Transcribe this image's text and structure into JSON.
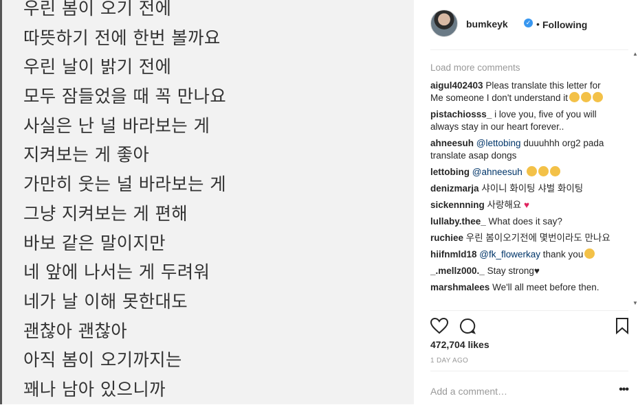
{
  "photo": {
    "lines": [
      "우린 봄이 오기 전에",
      "따뜻하기 전에 한번 볼까요",
      "우린 날이 밝기 전에",
      "모두 잠들었을 때 꼭 만나요",
      "사실은 난 널 바라보는 게",
      "지켜보는 게 좋아",
      "가만히 웃는 널 바라보는 게",
      "그냥 지켜보는 게 편해",
      "바보 같은 말이지만",
      "네 앞에 나서는 게 두려워",
      "네가 날 이해 못한대도",
      "괜찮아 괜찮아",
      "아직 봄이 오기까지는",
      "꽤나 남아 있으니까"
    ]
  },
  "header": {
    "username": "bumkeyk",
    "separator": "•",
    "follow_status": "Following"
  },
  "comments": {
    "load_more": "Load more comments",
    "items": [
      {
        "user": "aigul402403",
        "mention": "",
        "text": "Pleas translate this letter for Me someone I don't understand it",
        "emoji": 3
      },
      {
        "user": "pistachiosss_",
        "mention": "",
        "text": "i love you, five of you will always stay in our heart forever..",
        "emoji": 0
      },
      {
        "user": "ahneesuh",
        "mention": "@lettobing",
        "text": "duuuhhh org2 pada translate asap dongs",
        "emoji": 0
      },
      {
        "user": "lettobing",
        "mention": "@ahneesuh",
        "text": "",
        "emoji": 3
      },
      {
        "user": "denizmarja",
        "mention": "",
        "text": "샤이니 화이팅 샤벌 화이팅",
        "emoji": 0
      },
      {
        "user": "sickennning",
        "mention": "",
        "text": "사랑해요",
        "emoji": 0,
        "heart": "♥"
      },
      {
        "user": "lullaby.thee_",
        "mention": "",
        "text": "What does it say?",
        "emoji": 0
      },
      {
        "user": "ruchiee",
        "mention": "",
        "text": "우린 봄이오기전에 몇번이라도 만나요",
        "emoji": 0
      },
      {
        "user": "hiifnmld18",
        "mention": "@fk_flowerkay",
        "text": "thank you",
        "emoji": 1
      },
      {
        "user": "_.mellz000._",
        "mention": "",
        "text": "Stay strong♥",
        "emoji": 0
      },
      {
        "user": "marshmalees",
        "mention": "",
        "text": "We'll all meet before then.",
        "emoji": 0
      }
    ]
  },
  "likes": "472,704 likes",
  "age": "1 DAY AGO",
  "add_comment": {
    "placeholder": "Add a comment…",
    "more": "•••"
  },
  "icons": {
    "verified": "verified-badge-icon",
    "like": "heart-icon",
    "comment": "comment-bubble-icon",
    "save": "bookmark-icon",
    "more": "more-options-icon"
  }
}
